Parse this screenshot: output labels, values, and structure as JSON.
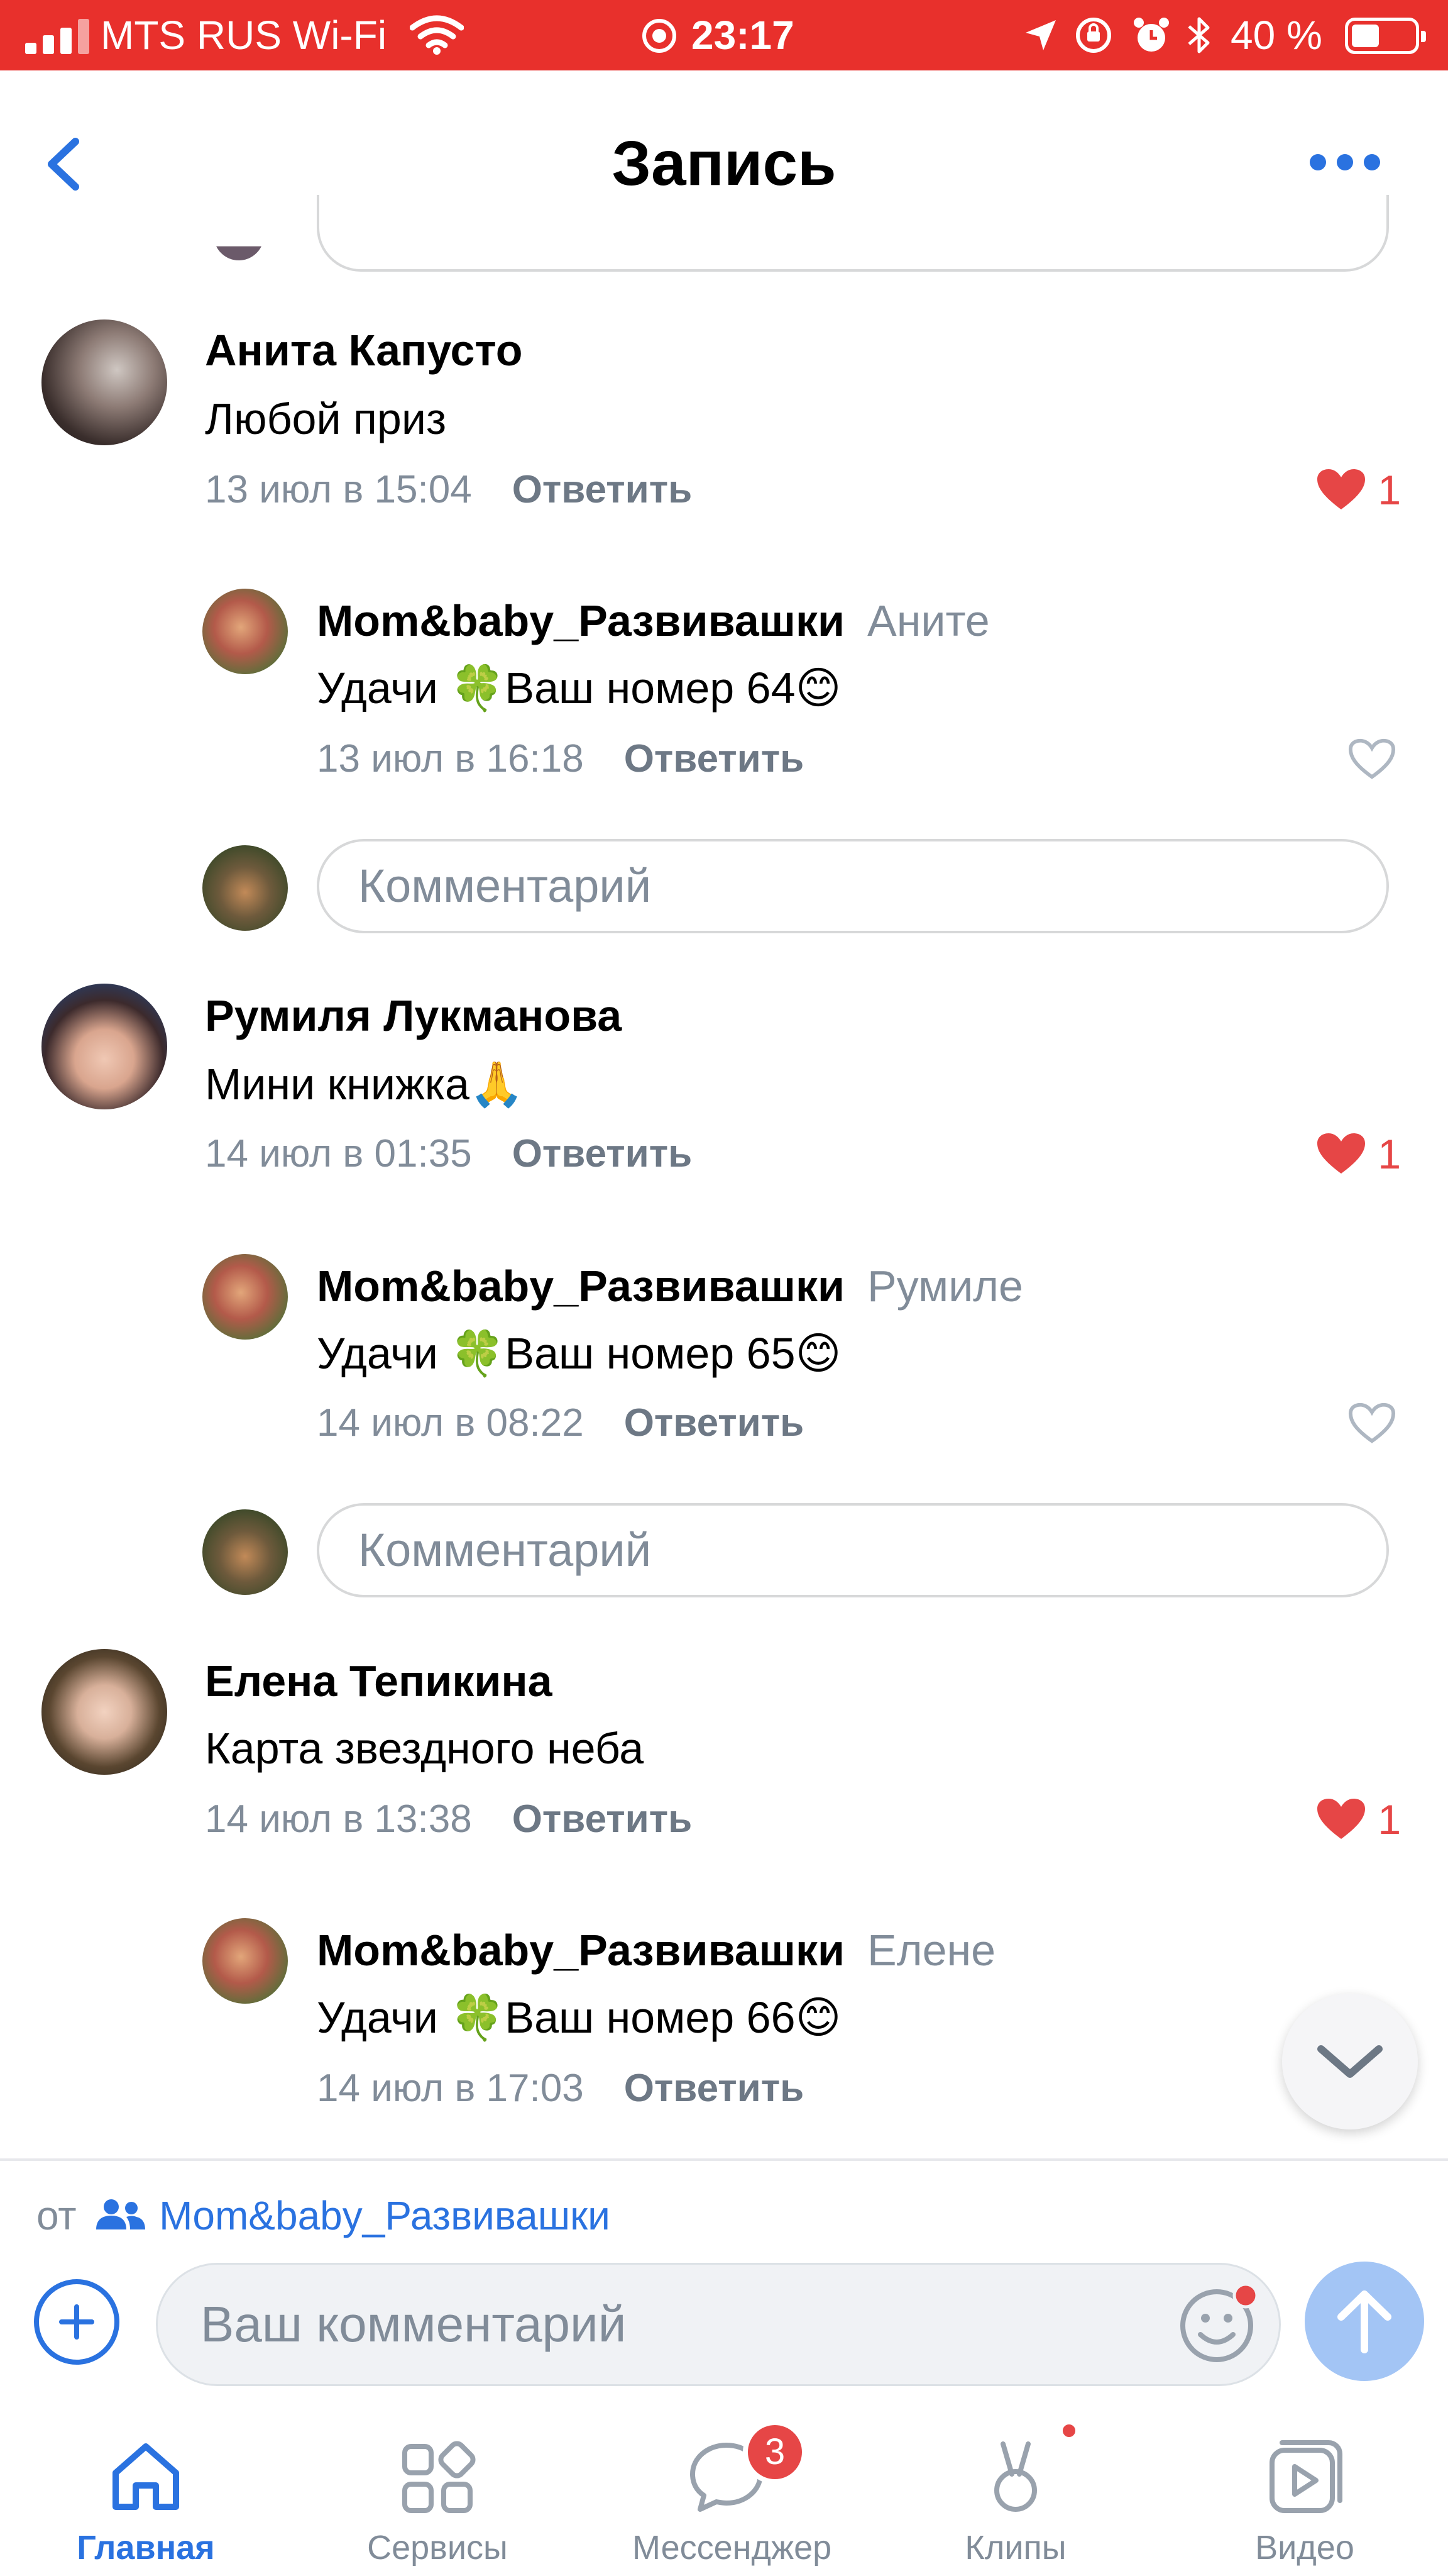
{
  "status_bar": {
    "carrier": "MTS RUS Wi-Fi",
    "time": "23:17",
    "battery": "40 %",
    "battery_level": 0.4
  },
  "header": {
    "title": "Запись",
    "back_icon": "chevron-left-icon",
    "more_icon": "more-horizontal-icon"
  },
  "comments": [
    {
      "author": "Анита Капусто",
      "text": "Любой приз",
      "time": "13 июл в 15:04",
      "reply_label": "Ответить",
      "likes": "1",
      "reply": {
        "author": "Mom&baby_Развивашки",
        "to": "Аните",
        "text": "Удачи 🍀Ваш номер 64😊",
        "time": "13 июл в 16:18",
        "reply_label": "Ответить"
      },
      "input_placeholder": "Комментарий"
    },
    {
      "author": "Румиля Лукманова",
      "text": "Мини книжка🙏",
      "time": "14 июл в 01:35",
      "reply_label": "Ответить",
      "likes": "1",
      "reply": {
        "author": "Mom&baby_Развивашки",
        "to": "Румиле",
        "text": "Удачи 🍀Ваш номер 65😊",
        "time": "14 июл в 08:22",
        "reply_label": "Ответить"
      },
      "input_placeholder": "Комментарий"
    },
    {
      "author": "Елена Тепикина",
      "text": "Карта звездного неба",
      "time": "14 июл в 13:38",
      "reply_label": "Ответить",
      "likes": "1",
      "reply": {
        "author": "Mom&baby_Развивашки",
        "to": "Елене",
        "text": "Удачи 🍀Ваш номер 66😊",
        "time": "14 июл в 17:03",
        "reply_label": "Ответить"
      }
    }
  ],
  "composer": {
    "from_prefix": "от",
    "from_group": "Mom&baby_Развивашки",
    "placeholder": "Ваш комментарий"
  },
  "tabs": [
    {
      "label": "Главная",
      "icon": "home-icon",
      "active": true
    },
    {
      "label": "Сервисы",
      "icon": "services-icon"
    },
    {
      "label": "Мессенджер",
      "icon": "messenger-icon",
      "badge": "3"
    },
    {
      "label": "Клипы",
      "icon": "clips-icon"
    },
    {
      "label": "Видео",
      "icon": "video-icon"
    }
  ],
  "colors": {
    "status_bar": "#e8302c",
    "accent": "#2a72e0",
    "like": "#e64646",
    "secondary_text": "#818c99"
  }
}
